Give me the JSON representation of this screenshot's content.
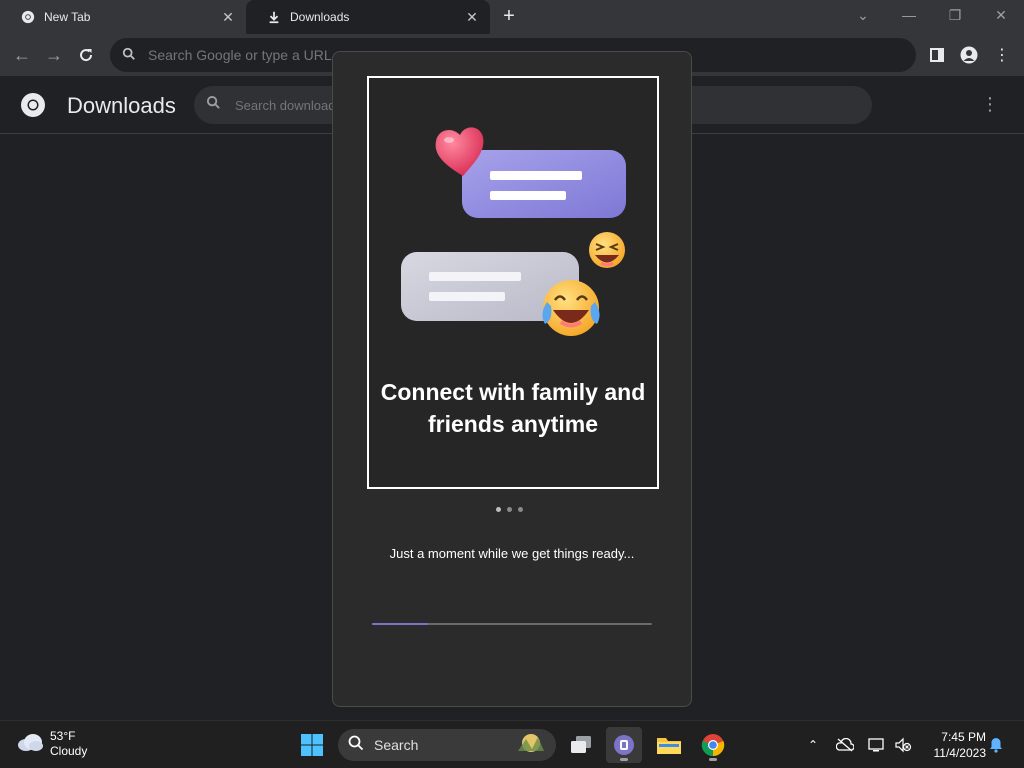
{
  "browser": {
    "tabs": [
      {
        "title": "New Tab",
        "icon": "chrome-icon"
      },
      {
        "title": "Downloads",
        "icon": "download-icon"
      }
    ],
    "omnibox_placeholder": "Search Google or type a URL"
  },
  "downloads_page": {
    "title": "Downloads",
    "search_placeholder": "Search downloads"
  },
  "dialog": {
    "slide_title": "Connect with family and friends anytime",
    "slide_count": 3,
    "active_slide": 1,
    "status_text": "Just a moment while we get things ready...",
    "progress_fraction": 0.2
  },
  "taskbar": {
    "weather": {
      "temperature": "53°F",
      "condition": "Cloudy"
    },
    "search_label": "Search",
    "apps": [
      "windows-start-icon",
      "task-view-icon",
      "teams-chat-icon",
      "file-explorer-icon",
      "chrome-icon"
    ],
    "clock": {
      "time": "7:45 PM",
      "date": "11/4/2023"
    }
  },
  "colors": {
    "accent": "#7b74c9",
    "chat_bubble_purple": "#8f89dd",
    "chat_bubble_grey": "#c9c9d4",
    "heart": "#e8456b"
  }
}
